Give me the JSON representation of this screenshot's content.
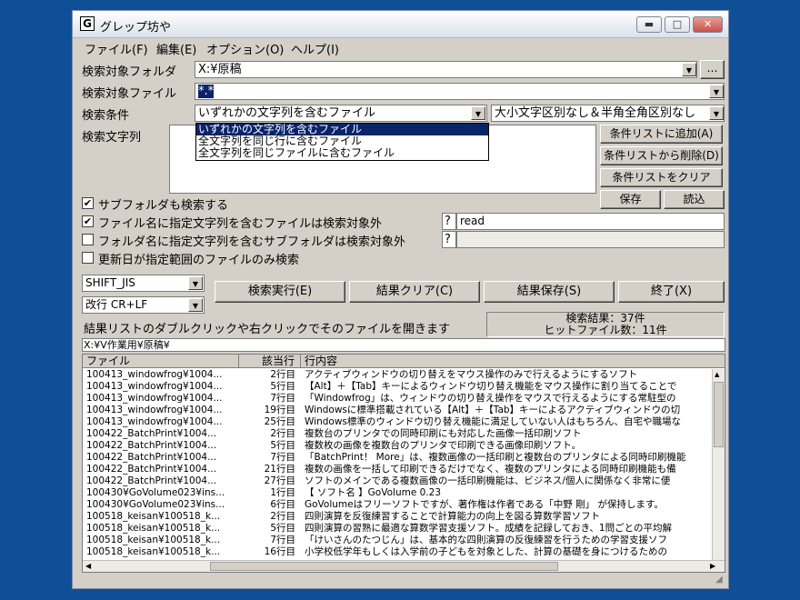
{
  "window": {
    "title": "グレップ坊や",
    "icon_letter": "G",
    "minimize": "▬",
    "maximize": "□",
    "close": "✕"
  },
  "menu": [
    "ファイル(F)",
    "編集(E)",
    "オプション(O)",
    "ヘルプ(I)"
  ],
  "form": {
    "folder_label": "検索対象フォルダ",
    "folder_value": "X:¥原稿",
    "browse_label": "…",
    "file_label": "検索対象ファイル",
    "file_value": "*.*",
    "condition_label": "検索条件",
    "condition_value": "いずれかの文字列を含むファイル",
    "case_value": "大小文字区別なし＆半角全角区別なし",
    "condition_options": [
      "いずれかの文字列を含むファイル",
      "全文字列を同じ行に含むファイル",
      "全文字列を同じファイルに含むファイル"
    ],
    "search_text_label": "検索文字列"
  },
  "side_buttons": {
    "add": "条件リストに追加(A)",
    "remove": "条件リストから削除(D)",
    "clear": "条件リストをクリア",
    "save": "保存",
    "load": "読込"
  },
  "options": [
    {
      "label": "サブフォルダも検索する",
      "checked": true,
      "mark": "✔"
    },
    {
      "label": "ファイル名に指定文字列を含むファイルは検索対象外",
      "checked": true,
      "mark": "✔",
      "prefix": "?",
      "value": "read"
    },
    {
      "label": "フォルダ名に指定文字列を含むサブフォルダは検索対象外",
      "checked": false,
      "mark": "",
      "prefix": "?",
      "value": ""
    },
    {
      "label": "更新日が指定範囲のファイルのみ検索",
      "checked": false,
      "mark": ""
    }
  ],
  "encoding": {
    "charset": "SHIFT_JIS",
    "newline": "改行 CR+LF"
  },
  "actions": {
    "run": "検索実行(E)",
    "clear": "結果クリア(C)",
    "save": "結果保存(S)",
    "exit": "終了(X)"
  },
  "hint": "結果リストのダブルクリックや右クリックでそのファイルを開きます",
  "stats": {
    "results": "検索結果：37件",
    "hit_files": "ヒットファイル数：11件"
  },
  "path": "X:¥V作業用¥原稿¥",
  "results": {
    "headers": [
      "ファイル",
      "該当行",
      "行内容"
    ],
    "rows": [
      [
        "100413_windowfrog¥1004...",
        "2行目",
        "アクティブウィンドウの切り替えをマウス操作のみで行えるようにするソフト"
      ],
      [
        "100413_windowfrog¥1004...",
        "5行目",
        "【Alt】＋【Tab】キーによるウィンドウ切り替え機能をマウス操作に割り当てることで"
      ],
      [
        "100413_windowfrog¥1004...",
        "7行目",
        "「Windowfrog」は、ウィンドウの切り替え操作をマウスで行えるようにする常駐型の"
      ],
      [
        "100413_windowfrog¥1004...",
        "19行目",
        "Windowsに標準搭載されている【Alt】＋【Tab】キーによるアクティブウィンドウの切"
      ],
      [
        "100413_windowfrog¥1004...",
        "25行目",
        "Windows標準のウィンドウ切り替え機能に満足していない人はもちろん、自宅や職場な"
      ],
      [
        "100422_BatchPrint¥1004...",
        "2行目",
        "複数台のプリンタでの同時印刷にも対応した画像一括印刷ソフト"
      ],
      [
        "100422_BatchPrint¥1004...",
        "5行目",
        "複数枚の画像を複数台のプリンタで印刷できる画像印刷ソフト。"
      ],
      [
        "100422_BatchPrint¥1004...",
        "7行目",
        "「BatchPrint！ More」は、複数画像の一括印刷と複数台のプリンタによる同時印刷機能"
      ],
      [
        "100422_BatchPrint¥1004...",
        "21行目",
        "複数の画像を一括して印刷できるだけでなく、複数のプリンタによる同時印刷機能も備"
      ],
      [
        "100422_BatchPrint¥1004...",
        "27行目",
        "ソフトのメインである複数画像の一括印刷機能は、ビジネス/個人に関係なく非常に便"
      ],
      [
        "100430¥GoVolume023¥ins...",
        "1行目",
        "【 ソフト名 】GoVolume 0.23"
      ],
      [
        "100430¥GoVolume023¥ins...",
        "6行目",
        "GoVolumeはフリーソフトですが、著作権は作者である「中野 剛」 が保持します。"
      ],
      [
        "100518_keisan¥100518_k...",
        "2行目",
        "四則演算を反復練習することで計算能力の向上を図る算数学習ソフト"
      ],
      [
        "100518_keisan¥100518_k...",
        "5行目",
        "四則演算の習熟に最適な算数学習支援ソフト。成績を記録しておき、1問ごとの平均解"
      ],
      [
        "100518_keisan¥100518_k...",
        "7行目",
        "「けいさんのたつじん」は、基本的な四則演算の反復練習を行うための学習支援ソフ"
      ],
      [
        "100518_keisan¥100518_k...",
        "16行目",
        "小学校低学年もしくは入学前の子どもを対象とした、計算の基礎を身につけるための"
      ]
    ]
  }
}
